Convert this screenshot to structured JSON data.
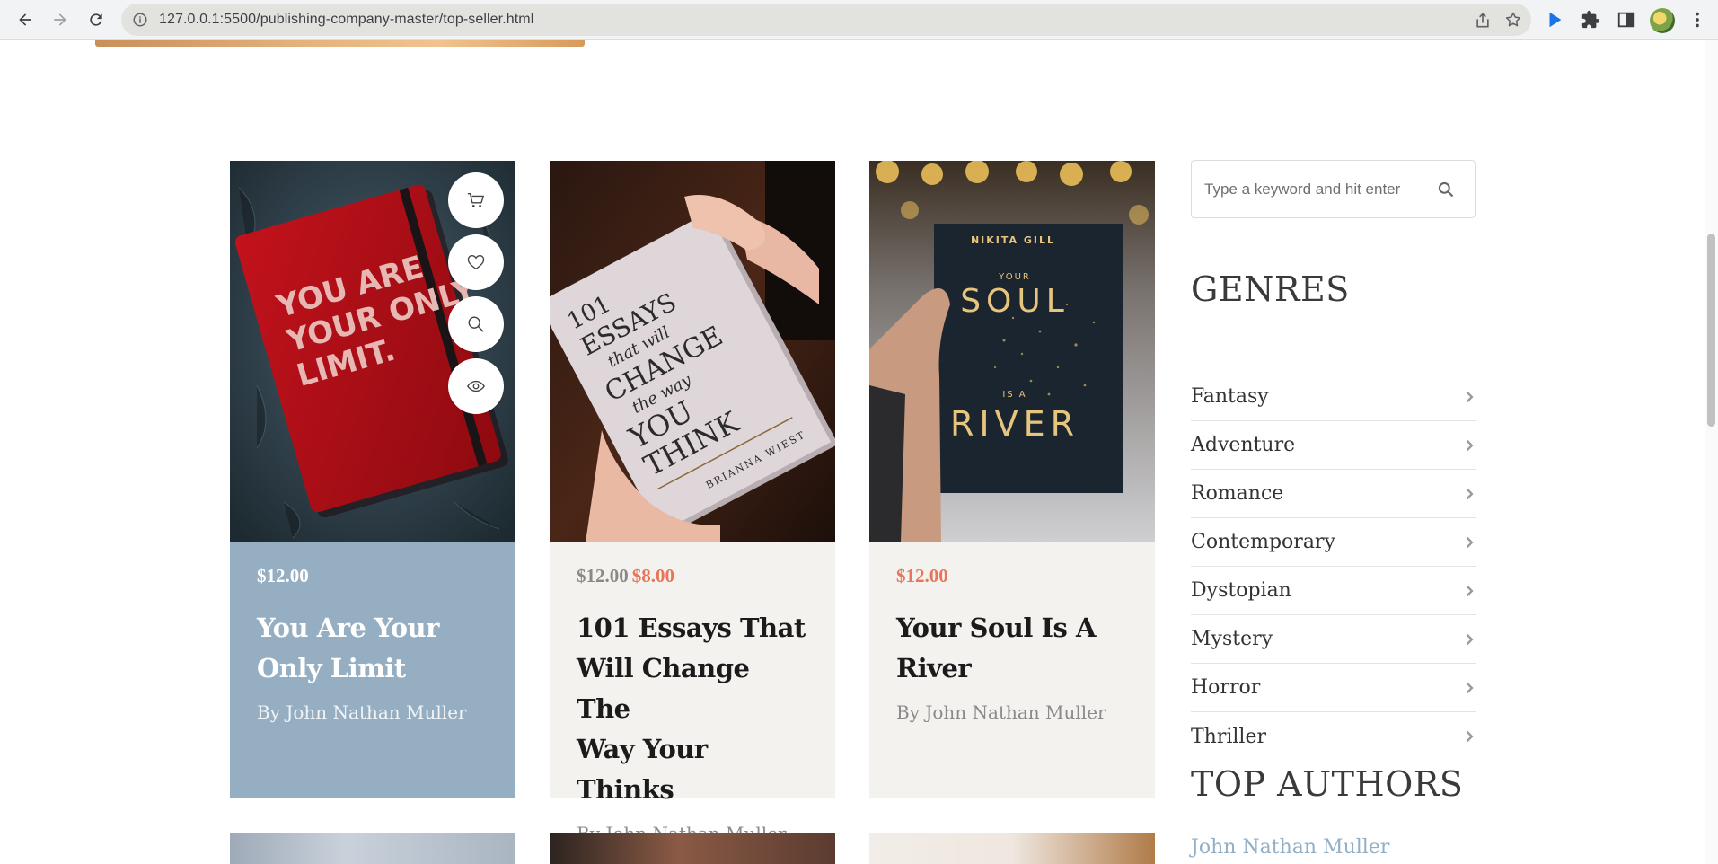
{
  "browser": {
    "url": "127.0.0.1:5500/publishing-company-master/top-seller.html"
  },
  "search": {
    "placeholder": "Type a keyword and hit enter"
  },
  "books": [
    {
      "price": "$12.00",
      "title_line1": "You Are Your",
      "title_line2": "Only Limit",
      "author": "By John Nathan Muller"
    },
    {
      "old_price": "$12.00",
      "price": "$8.00",
      "title_line1": "101 Essays That",
      "title_line2": "Will Change The",
      "title_line3": "Way Your Thinks",
      "author": "By John Nathan Muller"
    },
    {
      "price": "$12.00",
      "title_line1": "Your Soul Is A",
      "title_line2": "River",
      "author": "By John Nathan Muller"
    }
  ],
  "covers": {
    "book1": {
      "line1": "YOU ARE",
      "line2": "YOUR ONLY",
      "line3": "LIMIT."
    },
    "book2": {
      "line1": "101",
      "line2": "ESSAYS",
      "line3": "that will",
      "line4": "CHANGE",
      "line5": "the way",
      "line6": "YOU",
      "line7": "THINK",
      "author": "BRIANNA WIEST"
    },
    "book3": {
      "author": "NIKITA GILL",
      "line1": "YOUR",
      "line2": "SOUL",
      "line3": "IS A",
      "line4": "RIVER"
    }
  },
  "sidebar": {
    "genres_heading": "GENRES",
    "genres": [
      "Fantasy",
      "Adventure",
      "Romance",
      "Contemporary",
      "Dystopian",
      "Mystery",
      "Horror",
      "Thriller"
    ],
    "top_authors_heading": "TOP AUTHORS",
    "top_authors": [
      "John Nathan Muller"
    ]
  },
  "colors": {
    "accent_price": "#e8745a",
    "highlight_card": "#95aec2",
    "plain_card": "#f4f2ef",
    "author_link": "#93afc6"
  }
}
